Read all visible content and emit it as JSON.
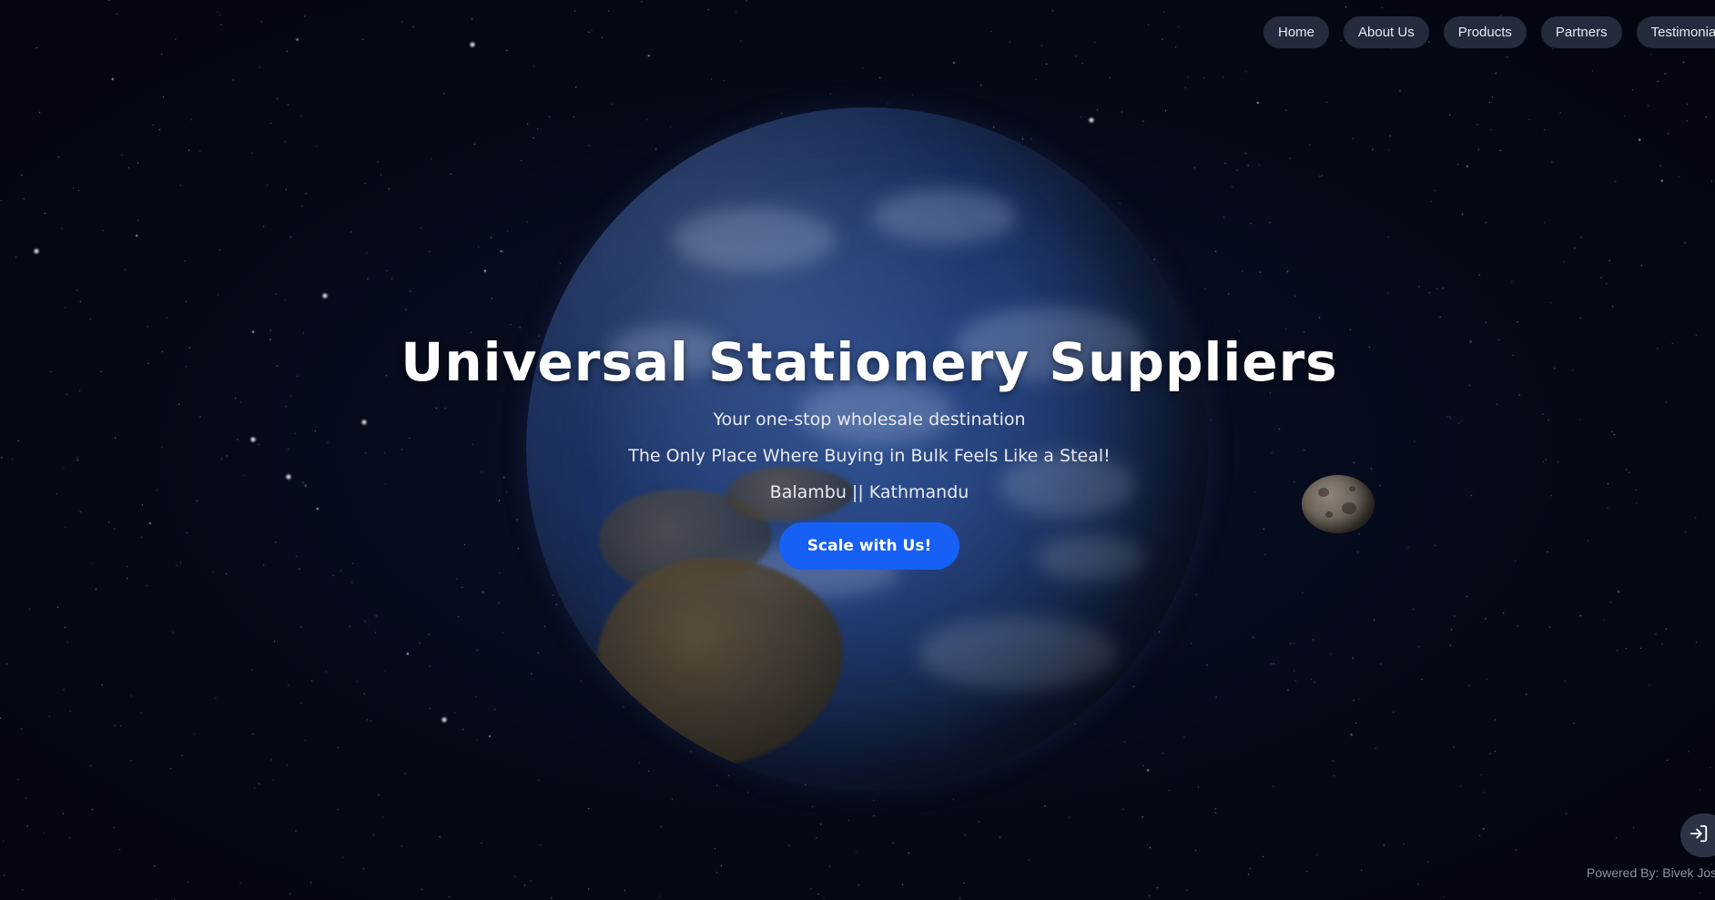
{
  "nav": {
    "items": [
      {
        "label": "Home"
      },
      {
        "label": "About Us"
      },
      {
        "label": "Products"
      },
      {
        "label": "Partners"
      },
      {
        "label": "Testimonials"
      }
    ]
  },
  "hero": {
    "title": "Universal Stationery Suppliers",
    "tagline": "Your one-stop wholesale destination",
    "slogan": "The Only Place Where Buying in Bulk Feels Like a Steal!",
    "location": "Balambu || Kathmandu",
    "cta_label": "Scale with Us!"
  },
  "footer": {
    "powered_by": "Powered By: Bivek Jos"
  },
  "icons": {
    "login": "sign-in-icon"
  },
  "colors": {
    "background": "#060a18",
    "nav_button": "#232b3c",
    "cta": "#1760f5",
    "earth_ocean": "#2e4f8e"
  }
}
